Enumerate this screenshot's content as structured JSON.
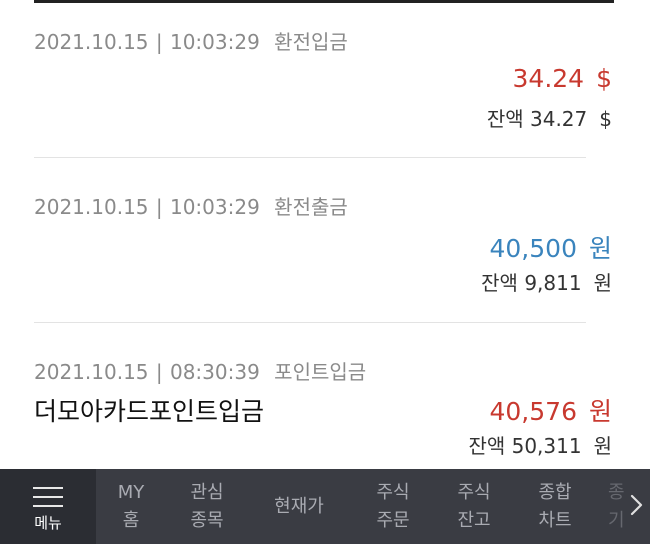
{
  "transactions": [
    {
      "date": "2021.10.15",
      "time": "10:03:29",
      "type": "환전입금",
      "description": "",
      "amount": "34.24",
      "amount_unit": "$",
      "amount_color": "#c8392f",
      "balance_label": "잔액",
      "balance": "34.27",
      "balance_unit": "$"
    },
    {
      "date": "2021.10.15",
      "time": "10:03:29",
      "type": "환전출금",
      "description": "",
      "amount": "40,500",
      "amount_unit": "원",
      "amount_color": "#3a84bd",
      "balance_label": "잔액",
      "balance": "9,811",
      "balance_unit": "원"
    },
    {
      "date": "2021.10.15",
      "time": "08:30:39",
      "type": "포인트입금",
      "description": "더모아카드포인트입금",
      "amount": "40,576",
      "amount_unit": "원",
      "amount_color": "#c8392f",
      "balance_label": "잔액",
      "balance": "50,311",
      "balance_unit": "원"
    }
  ],
  "bottom_nav": {
    "menu_label": "메뉴",
    "menu_icon": "hamburger-icon",
    "items": [
      {
        "line1": "MY",
        "line2": "홈"
      },
      {
        "line1": "관심",
        "line2": "종목"
      },
      {
        "line1": "현재가",
        "line2": ""
      },
      {
        "line1": "주식",
        "line2": "주문"
      },
      {
        "line1": "주식",
        "line2": "잔고"
      },
      {
        "line1": "종합",
        "line2": "차트"
      }
    ],
    "overflow_hint": {
      "line1": "종",
      "line2": "기"
    },
    "next_icon": "chevron-right-icon"
  }
}
